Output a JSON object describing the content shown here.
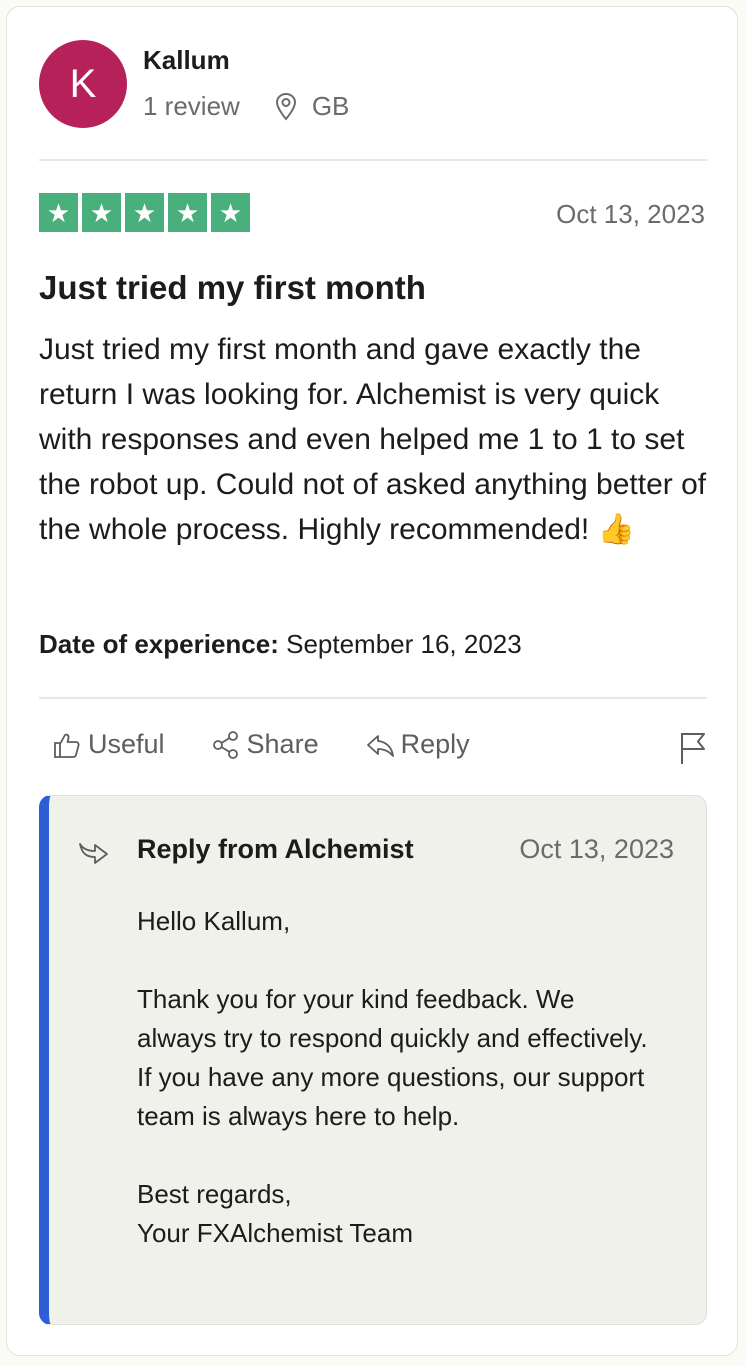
{
  "reviewer": {
    "initial": "K",
    "name": "Kallum",
    "reviews": "1 review",
    "country": "GB",
    "avatar_color": "#b6215a"
  },
  "review": {
    "rating": 5,
    "rating_max": 5,
    "star_color": "#49b07d",
    "date": "Oct 13, 2023",
    "title": "Just tried my first month",
    "text": "Just tried my first month and gave exactly the return I was looking for. Alchemist is very quick with responses and even helped me 1 to 1 to set the robot up. Could not of asked anything better of the whole process. Highly recommended! 👍",
    "experience_label": "Date of experience:",
    "experience_date": "September 16, 2023"
  },
  "actions": {
    "useful": "Useful",
    "share": "Share",
    "reply": "Reply"
  },
  "company_reply": {
    "from": "Reply from Alchemist",
    "date": "Oct 13, 2023",
    "accent_color": "#2c5fd6",
    "greeting": "Hello Kallum,",
    "message": "Thank you for your kind feedback. We always try to respond quickly and effectively. If you have any more questions, our support team is always here to help.",
    "closing": "Best regards,",
    "signature": "Your FXAlchemist Team"
  }
}
